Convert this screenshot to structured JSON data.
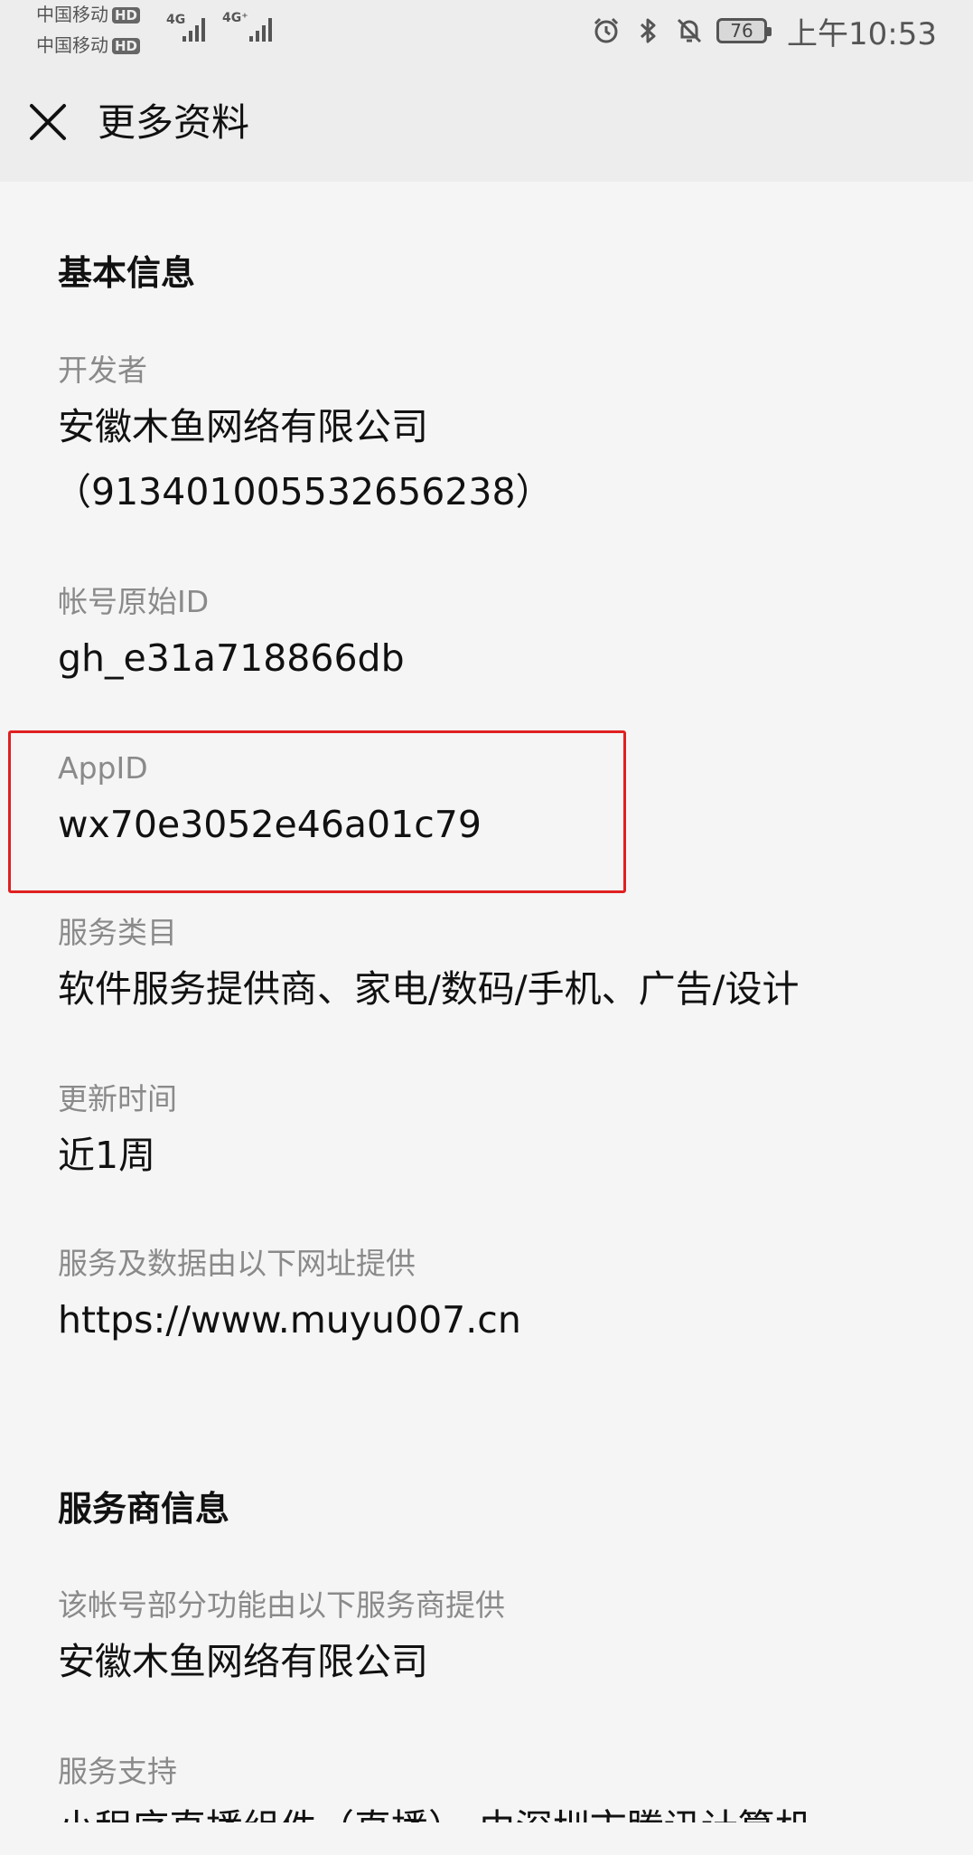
{
  "status_bar": {
    "carrier1": "中国移动",
    "carrier2": "中国移动",
    "hd_badge": "HD",
    "net1": "4G",
    "net2": "4G⁺",
    "battery": "76",
    "time": "上午10:53",
    "icons": [
      "alarm-icon",
      "bluetooth-icon",
      "mute-bell-icon"
    ]
  },
  "header": {
    "title": "更多资料",
    "close_icon": "close-icon"
  },
  "basic_info": {
    "section_title": "基本信息",
    "developer_label": "开发者",
    "developer_name": "安徽木鱼网络有限公司",
    "developer_code": "（91340100553265623​8）",
    "original_id_label": "帐号原始ID",
    "original_id_value": "gh_e31a718866db",
    "appid_label": "AppID",
    "appid_value": "wx70e3052e46a01c79",
    "category_label": "服务类目",
    "category_value": "软件服务提供商、家电/数码/手机、广告/设计",
    "update_label": "更新时间",
    "update_value": "近1周",
    "url_label": "服务及数据由以下网址提供",
    "url_value": "https://www.muyu007.cn"
  },
  "provider_info": {
    "section_title": "服务商信息",
    "provider_label": "该帐号部分功能由以下服务商提供",
    "provider_value": "安徽木鱼网络有限公司",
    "support_label": "服务支持",
    "support_value": "小程序直播组件（直播）-由深圳市腾讯计算机"
  },
  "colors": {
    "highlight_border": "#e02020",
    "background": "#f5f5f5",
    "header_bg": "#ededed"
  }
}
